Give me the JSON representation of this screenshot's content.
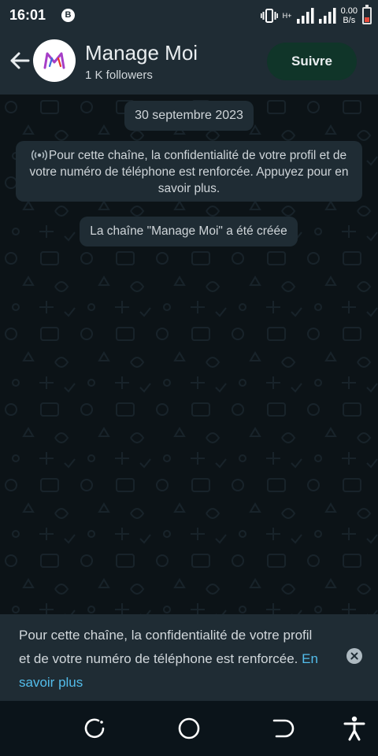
{
  "status_bar": {
    "time": "16:01",
    "notification_badge": "B",
    "network_type": "H+",
    "speed_value": "0.00",
    "speed_unit": "B/s",
    "battery_level_fraction": 0.35
  },
  "header": {
    "title": "Manage Moi",
    "subtitle": "1 K followers",
    "follow_button_label": "Suivre"
  },
  "chat": {
    "date_chip": "30 septembre 2023",
    "info_message": "Pour cette chaîne, la confidentialité de votre profil et de votre numéro de téléphone est renforcée. Appuyez pour en savoir plus.",
    "info_icon": "broadcast-icon",
    "created_message": "La chaîne \"Manage Moi\" a été créée"
  },
  "banner": {
    "text": "Pour cette chaîne, la confidentialité de votre profil et de votre numéro de téléphone est renforcée. ",
    "link_label": "En savoir plus"
  },
  "nav_bar": {
    "icons": [
      "recents-icon",
      "home-icon",
      "back-icon",
      "accessibility-icon"
    ]
  },
  "colors": {
    "header_bg": "#1f2c34",
    "chat_bg": "#0c1317",
    "follow_button_bg": "#103529",
    "link": "#53bdeb",
    "avatar_logo_accent": "#a63ec7"
  }
}
